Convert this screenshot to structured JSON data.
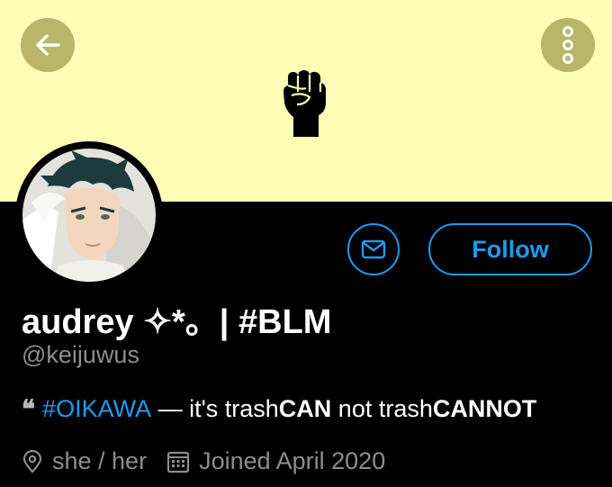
{
  "header": {
    "banner_color": "#fefdb6",
    "back_icon": "arrow-left-icon",
    "more_icon": "more-vertical-icon",
    "banner_symbol": "raised-fist-icon"
  },
  "actions": {
    "message_icon": "mail-icon",
    "follow_label": "Follow",
    "accent_color": "#1d9bf0"
  },
  "profile": {
    "display_name": "audrey ✧*。| #BLM",
    "handle": "@keijuwus",
    "bio": {
      "quote_mark": "❝",
      "hashtag": "#OIKAWA",
      "part1": " — it's trash",
      "bold1": "CAN",
      "part2": " not trash",
      "bold2": "CANNOT"
    },
    "pronouns": "she / her",
    "joined": "Joined April 2020"
  }
}
